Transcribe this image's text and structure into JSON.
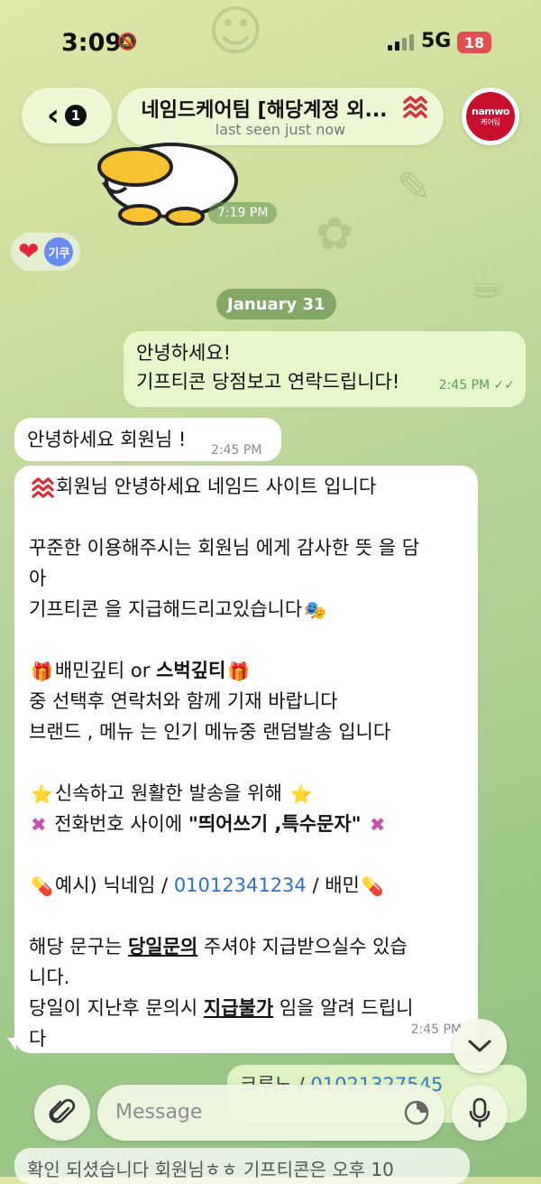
{
  "status_bar": {
    "time": "3:09",
    "network": "5G",
    "battery": "18"
  },
  "header": {
    "back_count": "1",
    "title": "네임드케어팀 [해당계정 외...",
    "subtitle": "last seen just now",
    "avatar_brand": "namwo",
    "avatar_sub": "케어팀"
  },
  "messages": {
    "sticker_time": "7:19 PM",
    "reaction_avatar": "기쿠",
    "date_separator": "January 31",
    "outgoing_1": {
      "text": "안녕하세요!\n기프티콘 당점보고 연락드립니다!",
      "time": "2:45 PM"
    },
    "incoming_1": {
      "text": "안녕하세요 회원님 !",
      "time": "2:45 PM"
    },
    "incoming_2": {
      "l1": "회원님 안녕하세요 네임드 사이트 입니다",
      "l2": "꾸준한 이용해주시는 회원님 에게 감사한 뜻 을 담",
      "l3": "아",
      "l4": "기프티콘 을 지급해드리고있습니다",
      "l5a": "배민깊티 or ",
      "l5b": "스벅깊티",
      "l6": "중 선택후 연락처와 함께 기재 바랍니다",
      "l7": "브랜드 , 메뉴 는 인기 메뉴중 랜덤발송 입니다",
      "l8": "신속하고 원활한 발송을 위해 ",
      "l9a": " 전화번호 사이에 ",
      "l9b": "\"띄어쓰기 ,특수문자\" ",
      "l10a": "예시)  닉네임 / ",
      "l10b": "01012341234",
      "l10c": " / 배민",
      "l11a": "해당 문구는 ",
      "l11b": "당일문의",
      "l11c": " 주셔야 지급받으실수 있습",
      "l12": "니다.",
      "l13a": "당일이 지난후 문의시 ",
      "l13b": "지급불가",
      "l13c": " 임을 알려 드립니",
      "l14": "다",
      "time": "2:45 PM"
    },
    "peek_outgoing": {
      "a": "크루노 / ",
      "b": "01021327545"
    },
    "peek_incoming": "확인 되셨습니다 회원님ㅎㅎ 기프티콘은 오후 10"
  },
  "composer": {
    "placeholder": "Message"
  },
  "colors": {
    "accent_red": "#e0303e",
    "link_blue": "#2d6fcf",
    "outgoing_bg": "#e6f7c9"
  }
}
